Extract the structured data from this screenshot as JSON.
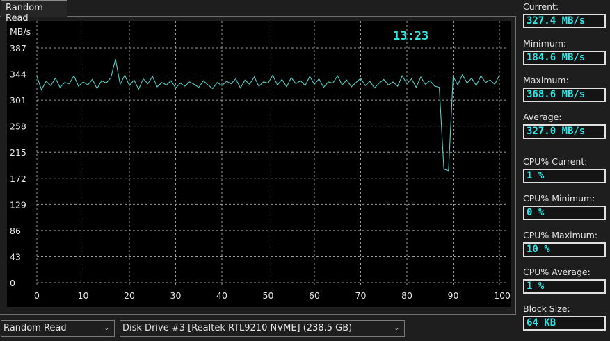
{
  "tab": {
    "label": "Random Read"
  },
  "clock": "13:23",
  "stats": [
    {
      "label": "Current:",
      "value": "327.4 MB/s"
    },
    {
      "label": "Minimum:",
      "value": "184.6 MB/s"
    },
    {
      "label": "Maximum:",
      "value": "368.6 MB/s"
    },
    {
      "label": "Average:",
      "value": "327.0 MB/s"
    },
    {
      "label": "CPU% Current:",
      "value": "1 %"
    },
    {
      "label": "CPU% Minimum:",
      "value": "0 %"
    },
    {
      "label": "CPU% Maximum:",
      "value": "10 %"
    },
    {
      "label": "CPU% Average:",
      "value": "1 %"
    },
    {
      "label": "Block Size:",
      "value": "64 KB"
    }
  ],
  "controls": {
    "test_select": "Random Read",
    "drive_select": "Disk Drive #3  [Realtek RTL9210 NVME]  (238.5 GB)"
  },
  "colors": {
    "line": "#4fd0c8",
    "accent": "#2ee6e6",
    "grid": "#9a9a9a"
  },
  "chart_data": {
    "type": "line",
    "ylabel": "MB/s",
    "ylim": [
      0,
      387
    ],
    "xlim": [
      0,
      100
    ],
    "yticks": [
      "387",
      "344",
      "301",
      "258",
      "215",
      "172",
      "129",
      "86",
      "43",
      "0"
    ],
    "ytick_values": [
      387,
      344,
      301,
      258,
      215,
      172,
      129,
      86,
      43,
      0
    ],
    "xticks": [
      "0",
      "10",
      "20",
      "30",
      "40",
      "50",
      "60",
      "70",
      "80",
      "90",
      "100 %"
    ],
    "xtick_values": [
      0,
      10,
      20,
      30,
      40,
      50,
      60,
      70,
      80,
      90,
      100
    ],
    "grid": true,
    "series": [
      {
        "name": "Random Read",
        "x_step": 1,
        "values": [
          340,
          318,
          332,
          325,
          337,
          322,
          330,
          328,
          341,
          324,
          331,
          326,
          335,
          320,
          333,
          329,
          338,
          368.6,
          327,
          342,
          325,
          334,
          319,
          336,
          328,
          340,
          323,
          330,
          326,
          333,
          321,
          329,
          324,
          331,
          327,
          322,
          333,
          326,
          320,
          330,
          325,
          332,
          328,
          336,
          321,
          334,
          327,
          339,
          324,
          331,
          329,
          342,
          326,
          335,
          323,
          338,
          328,
          333,
          325,
          340,
          327,
          336,
          322,
          331,
          329,
          341,
          326,
          334,
          323,
          330,
          337,
          325,
          332,
          321,
          329,
          335,
          326,
          331,
          324,
          341,
          328,
          336,
          322,
          339,
          327,
          333,
          324,
          322,
          187,
          184.6,
          340,
          326,
          343,
          329,
          337,
          325,
          341,
          330,
          334,
          327,
          342
        ]
      }
    ]
  }
}
